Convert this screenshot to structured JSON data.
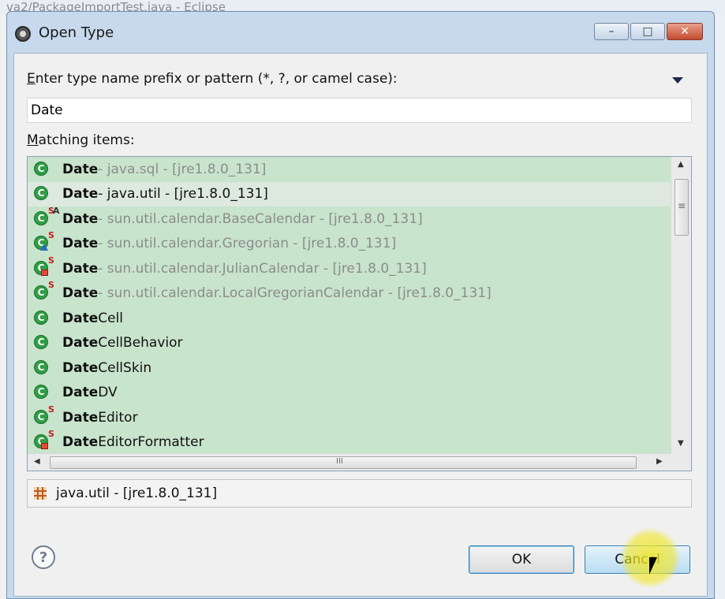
{
  "background": {
    "window_title": "va2/PackageImportTest.java - Eclipse"
  },
  "dialog": {
    "title": "Open Type",
    "title_icon": "gear-icon",
    "window_controls": {
      "minimize": "–",
      "maximize": "□",
      "close": "✕"
    }
  },
  "prompt": {
    "accesskey": "E",
    "label_rest": "nter type name prefix or pattern (*, ?, or camel case):"
  },
  "search": {
    "value": "Date"
  },
  "matching": {
    "accesskey": "M",
    "label_rest": "atching items:"
  },
  "items": [
    {
      "name": "Date",
      "rest": "",
      "qualifier": " - java.sql - [jre1.8.0_131]",
      "overlay": "",
      "selected": false
    },
    {
      "name": "Date",
      "rest": "",
      "qualifier": " - java.util - [jre1.8.0_131]",
      "overlay": "",
      "selected": true
    },
    {
      "name": "Date",
      "rest": "",
      "qualifier": " - sun.util.calendar.BaseCalendar - [jre1.8.0_131]",
      "overlay": "SA",
      "selected": false
    },
    {
      "name": "Date",
      "rest": "",
      "qualifier": " - sun.util.calendar.Gregorian - [jre1.8.0_131]",
      "overlay": "S-tri",
      "selected": false
    },
    {
      "name": "Date",
      "rest": "",
      "qualifier": " - sun.util.calendar.JulianCalendar - [jre1.8.0_131]",
      "overlay": "S-lock",
      "selected": false
    },
    {
      "name": "Date",
      "rest": "",
      "qualifier": " - sun.util.calendar.LocalGregorianCalendar - [jre1.8.0_131]",
      "overlay": "S",
      "selected": false
    },
    {
      "name": "Date",
      "rest": "Cell",
      "qualifier": "",
      "overlay": "",
      "selected": false
    },
    {
      "name": "Date",
      "rest": "CellBehavior",
      "qualifier": "",
      "overlay": "",
      "selected": false
    },
    {
      "name": "Date",
      "rest": "CellSkin",
      "qualifier": "",
      "overlay": "",
      "selected": false
    },
    {
      "name": "Date",
      "rest": "DV",
      "qualifier": "",
      "overlay": "",
      "selected": false
    },
    {
      "name": "Date",
      "rest": "Editor",
      "qualifier": "",
      "overlay": "S",
      "selected": false
    },
    {
      "name": "Date",
      "rest": "EditorFormatter",
      "qualifier": "",
      "overlay": "S-lock",
      "selected": false
    }
  ],
  "details": {
    "text": "java.util - [jre1.8.0_131]",
    "icon": "package-icon"
  },
  "buttons": {
    "ok": "OK",
    "cancel": "Cancel",
    "help": "?"
  },
  "scroll": {
    "up": "▲",
    "down": "▼",
    "left": "◀",
    "right": "▶",
    "grip": "≡",
    "hgrip": "III"
  },
  "colors": {
    "list_bg": "#c8e4cc",
    "class_icon": "#2f9e45",
    "selected_row": "#dde9de"
  }
}
